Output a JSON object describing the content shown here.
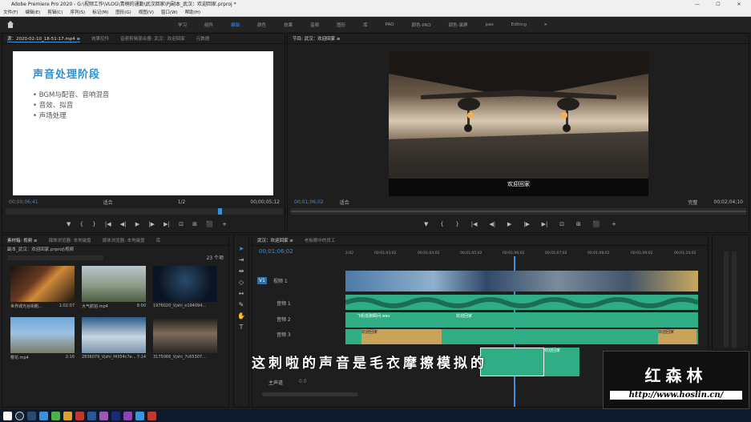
{
  "app": {
    "title": "Adobe Premiere Pro 2020 - G:\\视频工作\\VLOG\\青桐的通勤\\武汉回家\\PJ副本_武汉：欢迎回家.prproj *",
    "minimize": "—",
    "maximize": "☐",
    "close": "✕"
  },
  "menu": [
    "文件(F)",
    "编辑(E)",
    "剪辑(C)",
    "序列(S)",
    "标记(M)",
    "图形(G)",
    "视图(V)",
    "窗口(W)",
    "帮助(H)"
  ],
  "workspaces": {
    "home_icon": "home-icon",
    "items": [
      "学习",
      "组件",
      "编辑",
      "颜色",
      "效果",
      "音频",
      "图形",
      "库",
      "PAO",
      "颜色-PAO",
      "调色-录屏",
      "pao",
      "Editing"
    ],
    "active": "编辑",
    "more": "»"
  },
  "source": {
    "tabs": [
      "源：2020-02-10_18-51-17.mp4 ≡",
      "效果控件",
      "音频剪辑混合器: 武汉：欢迎回家",
      "元数据"
    ],
    "slide": {
      "heading": "声音处理阶段",
      "bullets": [
        "• BGM与配音、音响混音",
        "• 音效、拟音",
        "• 声场处理"
      ]
    },
    "timecode": "00;00;06;41",
    "fit": "适合",
    "page": "1/2",
    "duration": "00;00;05;12"
  },
  "program": {
    "tab": "节目: 武汉：欢迎回家 ≡",
    "subtitle": "欢迎回家",
    "timecode": "00;01;06;02",
    "fit": "适合",
    "quality": "完整",
    "duration": "00;02;04;10"
  },
  "transport": [
    "▼",
    "{",
    "}",
    "|◀",
    "◀|",
    "▶",
    "|▶",
    "▶|",
    "⊡",
    "⊞",
    "⬛",
    "+"
  ],
  "project": {
    "tabs": [
      "素材箱: 视频 ≡",
      "媒体浏览器: 本地磁盘",
      "媒体浏览器: 本地磁盘",
      "库"
    ],
    "path": "副本_武汉：欢迎回家.prproj\\视频",
    "count": "23 个项",
    "clips": [
      {
        "name": "世界城光谷街衢...",
        "dur": "1:02:07"
      },
      {
        "name": "大气航拍.mp4",
        "dur": "8:00"
      },
      {
        "name": "1976020_Vjshi_e194094...",
        "dur": ""
      },
      {
        "name": "樱花.mp4",
        "dur": "2:16"
      },
      {
        "name": "2836079_Vjshi_f4354c7e...",
        "dur": "7:14"
      },
      {
        "name": "3175066_Vjshi_7c65307...",
        "dur": ""
      }
    ]
  },
  "timeline": {
    "tabs": [
      "武汉：欢迎回家 ≡",
      "老板眼中的员工"
    ],
    "timecode": "00;01;06;02",
    "ruler": [
      "2;02",
      "00;01;03;02",
      "00;01;04;02",
      "00;01;05;02",
      "00;01;06;02",
      "00;01;07;02",
      "00;01;08;02",
      "00;01;09;02",
      "00;01;10;02"
    ],
    "tracks": [
      {
        "id": "V1",
        "name": "视频 1"
      },
      {
        "id": "A1",
        "name": "音频 1"
      },
      {
        "id": "A2",
        "name": "音频 2"
      },
      {
        "id": "A3",
        "name": "音频 3"
      }
    ],
    "master": {
      "label": "主声道",
      "value": "0.0"
    },
    "clip_labels": [
      "飞机低跑瞬间.wav",
      "欢迎回家",
      "欢迎回家",
      "欢迎回家",
      "欢迎回家"
    ]
  },
  "overlay": {
    "subtitle": "这刺啦的声音是毛衣摩擦模拟的",
    "brand": "红森林",
    "url": "http://www.hoslin.cn/"
  },
  "meter": {
    "value": "18"
  },
  "colors": {
    "accent": "#3d8fe0",
    "audio": "#2fae86",
    "video": "#5a84b5",
    "label": "#c9a35a"
  }
}
